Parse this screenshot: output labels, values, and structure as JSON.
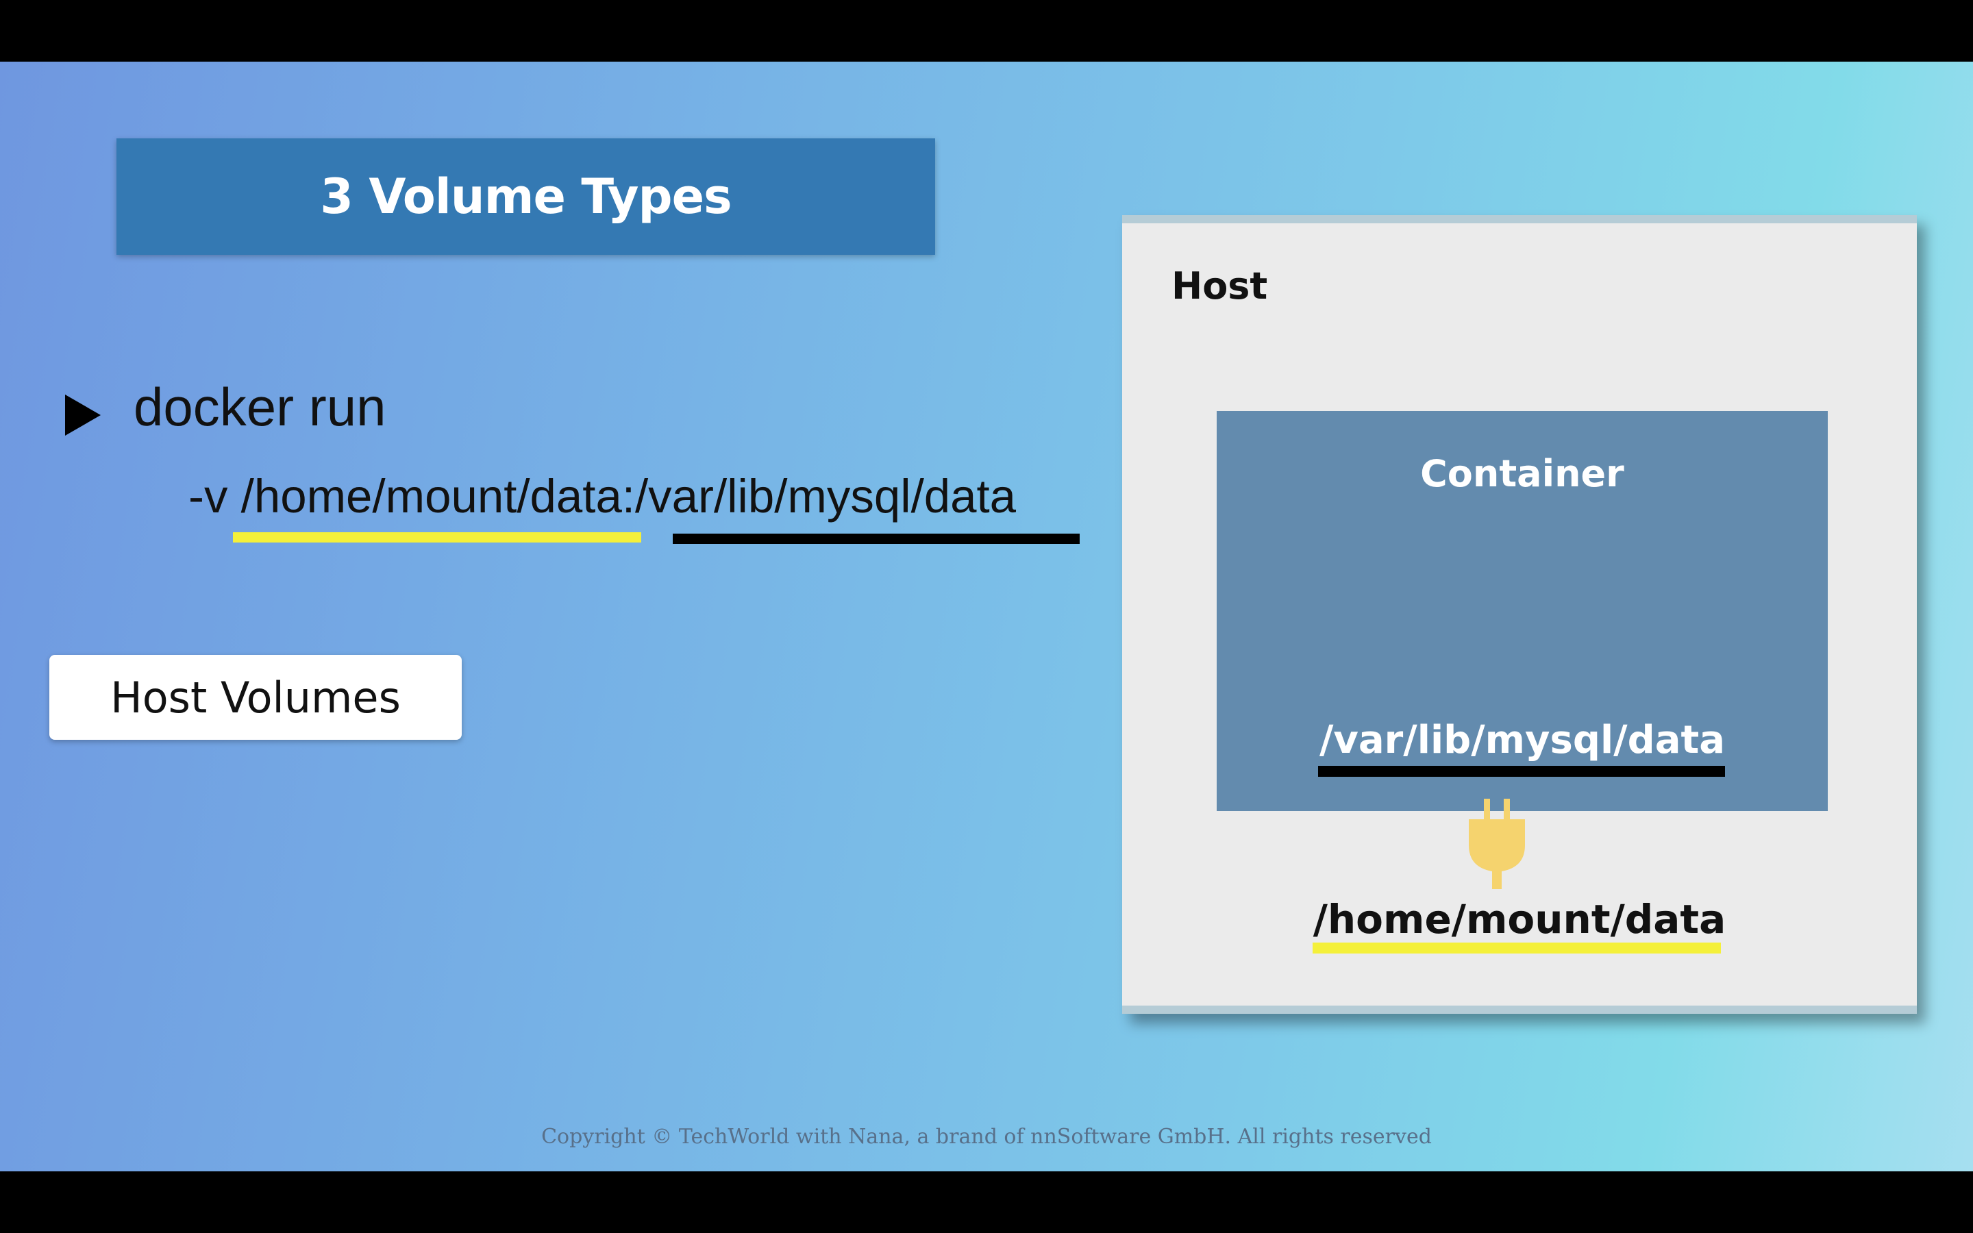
{
  "slide": {
    "title": "3 Volume Types",
    "command": {
      "run": "docker run",
      "flag": "-v ",
      "host_path": "/home/mount/data",
      "separator": ":",
      "container_path": "/var/lib/mysql/data"
    },
    "volume_type_label": "Host Volumes",
    "copyright": "Copyright © TechWorld with Nana, a brand of nnSoftware GmbH. All rights reserved"
  },
  "diagram": {
    "host_label": "Host",
    "container_label": "Container",
    "container_path": "/var/lib/mysql/data",
    "host_path": "/home/mount/data",
    "connector_icon": "plug-icon"
  },
  "colors": {
    "title_bar": "#3479b3",
    "container_box": "#638bae",
    "host_box": "#ebebeb",
    "host_path_underline": "#f4f03a",
    "container_path_underline": "#000000",
    "plug": "#f5d36e"
  }
}
